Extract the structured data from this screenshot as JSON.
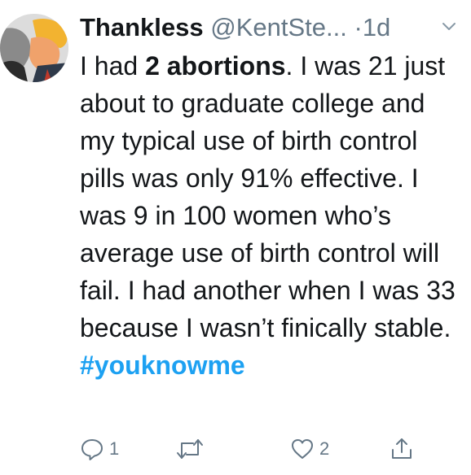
{
  "tweet": {
    "display_name": "Thankless",
    "handle": "@KentSte...",
    "separator": "·",
    "time": "1d",
    "text_parts": {
      "p1": "I had ",
      "p2": "2 abortions",
      "p3": ". I was 21 just about to graduate college and my typical use of birth control pills was only 91% effective. I was 9 in 100 women who’s  average use of birth control will fail. I had another when I was 33 because I wasn’t finically stable. ",
      "hashtag": "#youknowme"
    }
  },
  "actions": {
    "reply_icon": "reply-icon",
    "reply_count": "1",
    "retweet_icon": "retweet-icon",
    "like_icon": "heart-icon",
    "like_count": "2",
    "share_icon": "share-icon"
  },
  "colors": {
    "text": "#14171a",
    "muted": "#657786",
    "link": "#1da1f2"
  }
}
